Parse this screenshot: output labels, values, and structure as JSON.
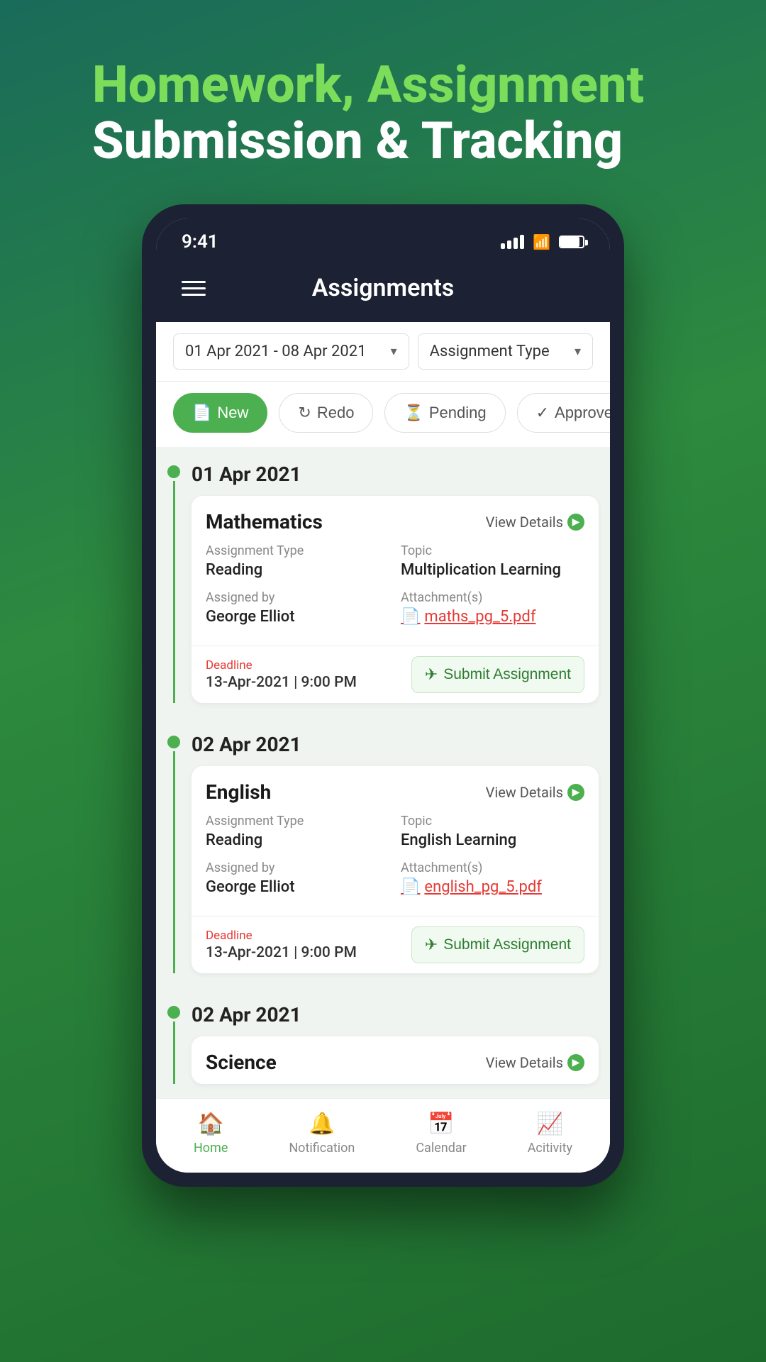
{
  "hero": {
    "line1": "Homework, Assignment",
    "line2": "Submission & Tracking"
  },
  "statusBar": {
    "time": "9:41"
  },
  "header": {
    "title": "Assignments"
  },
  "filters": {
    "dateRange": "01 Apr 2021 - 08 Apr 2021",
    "assignmentType": "Assignment Type"
  },
  "tabs": [
    {
      "id": "new",
      "label": "New",
      "icon": "📄",
      "active": true
    },
    {
      "id": "redo",
      "label": "Redo",
      "icon": "↻",
      "active": false
    },
    {
      "id": "pending",
      "label": "Pending",
      "icon": "⏳",
      "active": false
    },
    {
      "id": "approved",
      "label": "Approved",
      "icon": "✓",
      "active": false
    }
  ],
  "dateGroups": [
    {
      "date": "01 Apr 2021",
      "assignments": [
        {
          "subject": "Mathematics",
          "viewDetailsLabel": "View Details",
          "fields": {
            "assignmentTypeLabel": "Assignment Type",
            "assignmentTypeValue": "Reading",
            "topicLabel": "Topic",
            "topicValue": "Multiplication Learning",
            "assignedByLabel": "Assigned by",
            "assignedByValue": "George Elliot",
            "attachmentsLabel": "Attachment(s)",
            "attachmentFile": "maths_pg_5.pdf"
          },
          "deadlineLabel": "Deadline",
          "deadlineValue": "13-Apr-2021 | 9:00 PM",
          "submitLabel": "Submit Assignment"
        }
      ]
    },
    {
      "date": "02 Apr 2021",
      "assignments": [
        {
          "subject": "English",
          "viewDetailsLabel": "View Details",
          "fields": {
            "assignmentTypeLabel": "Assignment Type",
            "assignmentTypeValue": "Reading",
            "topicLabel": "Topic",
            "topicValue": "English Learning",
            "assignedByLabel": "Assigned by",
            "assignedByValue": "George Elliot",
            "attachmentsLabel": "Attachment(s)",
            "attachmentFile": "english_pg_5.pdf"
          },
          "deadlineLabel": "Deadline",
          "deadlineValue": "13-Apr-2021 | 9:00 PM",
          "submitLabel": "Submit Assignment"
        }
      ]
    },
    {
      "date": "02 Apr 2021",
      "assignments": [
        {
          "subject": "Science",
          "viewDetailsLabel": "View Details"
        }
      ]
    }
  ],
  "bottomNav": [
    {
      "id": "home",
      "label": "Home",
      "icon": "🏠",
      "active": true
    },
    {
      "id": "notification",
      "label": "Notification",
      "icon": "🔔",
      "active": false
    },
    {
      "id": "calendar",
      "label": "Calendar",
      "icon": "📅",
      "active": false
    },
    {
      "id": "activity",
      "label": "Acitivity",
      "icon": "📈",
      "active": false
    }
  ]
}
